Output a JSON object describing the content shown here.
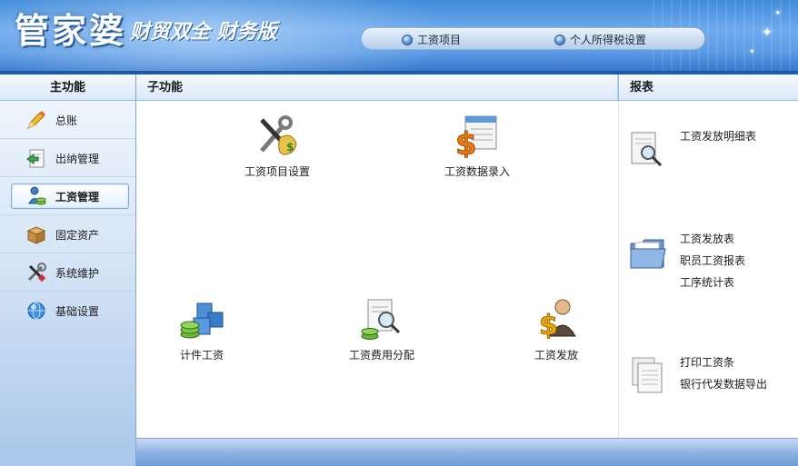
{
  "brand": {
    "name": "管家婆",
    "subtitle": "财贸双全 财务版"
  },
  "top_nav": [
    {
      "label": "工资项目"
    },
    {
      "label": "个人所得税设置"
    }
  ],
  "sidebar": {
    "title": "主功能",
    "items": [
      {
        "label": "总账",
        "icon": "pencil-icon",
        "active": false
      },
      {
        "label": "出纳管理",
        "icon": "cashier-icon",
        "active": false
      },
      {
        "label": "工资管理",
        "icon": "payroll-icon",
        "active": true
      },
      {
        "label": "固定资产",
        "icon": "box-icon",
        "active": false
      },
      {
        "label": "系统维护",
        "icon": "tools-icon",
        "active": false
      },
      {
        "label": "基础设置",
        "icon": "globe-icon",
        "active": false
      }
    ]
  },
  "subfunctions": {
    "title": "子功能",
    "items": [
      {
        "label": "工资项目设置",
        "icon": "wrench-money-icon"
      },
      {
        "label": "工资数据录入",
        "icon": "dollar-form-icon"
      },
      {
        "label": "计件工资",
        "icon": "blocks-coins-icon"
      },
      {
        "label": "工资费用分配",
        "icon": "document-magnifier-icon"
      },
      {
        "label": "工资发放",
        "icon": "dollar-person-icon"
      }
    ]
  },
  "reports": {
    "title": "报表",
    "groups": [
      {
        "icon": "document-search-icon",
        "links": [
          "工资发放明细表"
        ]
      },
      {
        "icon": "folder-icon",
        "links": [
          "工资发放表",
          "职员工资报表",
          "工序统计表"
        ]
      },
      {
        "icon": "pages-icon",
        "links": [
          "打印工资条",
          "银行代发数据导出"
        ]
      }
    ]
  },
  "colors": {
    "banner": "#5b9ae5",
    "accent": "#2e72c6",
    "sidebar_active_border": "#7ea7d7"
  }
}
